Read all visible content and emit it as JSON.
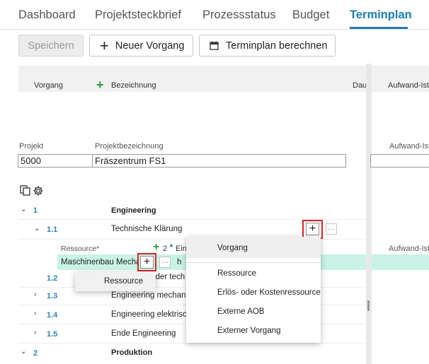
{
  "tabs": [
    "Dashboard",
    "Projektsteckbrief",
    "Prozessstatus",
    "Budget",
    "Terminplan"
  ],
  "toolbar": {
    "save": "Speichern",
    "new_task": "Neuer Vorgang",
    "calc": "Terminplan berechnen"
  },
  "grid": {
    "col_vorgang": "Vorgang",
    "col_bezeichnung": "Bezeichnung",
    "col_dau": "Dau",
    "col_aufwand": "Aufwand-Ist"
  },
  "project": {
    "label_projekt": "Projekt",
    "label_bez": "Projektbezeichnung",
    "projekt": "5000",
    "bezeichnung": "Fräszentrum FS1",
    "label_aufwand": "Aufwand-Ist"
  },
  "rows": [
    {
      "num": "1",
      "name": "Engineering"
    },
    {
      "num": "1.1",
      "name": "Technische Klärung"
    },
    {
      "num": "1.2",
      "name": "g der tech"
    },
    {
      "num": "1.3",
      "name": "Engineering mechanis"
    },
    {
      "num": "1.4",
      "name": "Engineering elektrisch"
    },
    {
      "num": "1.5",
      "name": "Ende Engineering"
    },
    {
      "num": "2",
      "name": "Produktion"
    }
  ],
  "resource": {
    "label": "Ressource*",
    "count": "2",
    "count_suffix": "Ein",
    "value": "Maschinenbau Mechan",
    "unit": "h",
    "aufwand_label": "Aufwand-Ist"
  },
  "menu_small": [
    "Ressource"
  ],
  "menu_large": {
    "top": "Vorgang",
    "items": [
      "Ressource",
      "Erlös- oder Kostenressource",
      "Externe AOB",
      "Externer Vorgang"
    ]
  }
}
